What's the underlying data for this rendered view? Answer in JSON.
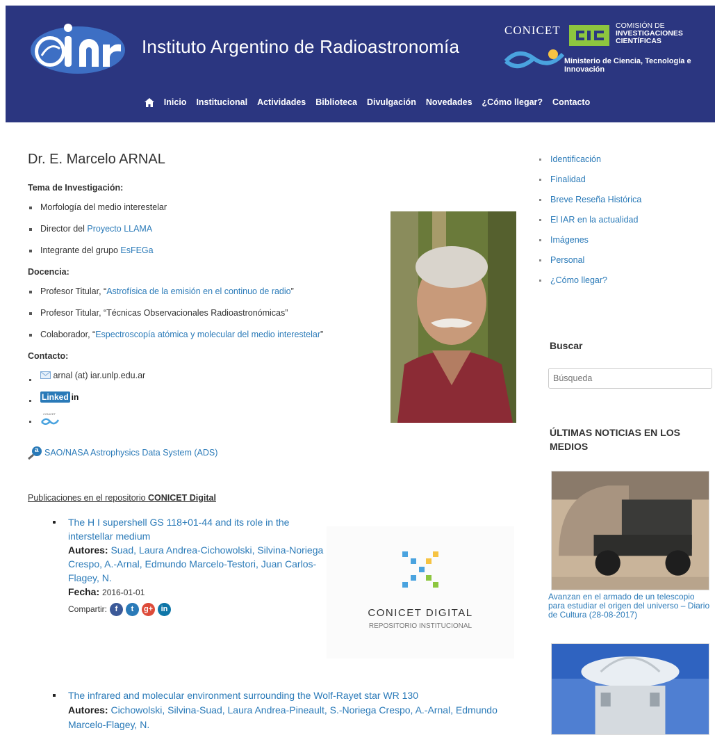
{
  "header": {
    "logo_text": "iar",
    "site_title": "Instituto Argentino de Radioastronomía",
    "partner": {
      "conicet": "CONICET",
      "cic_line1": "COMISIÓN DE",
      "cic_line2": "INVESTIGACIONES CIENTÍFICAS",
      "ministerio": "Ministerio de Ciencia, Tecnología e Innovación"
    }
  },
  "nav": {
    "items": [
      "Inicio",
      "Institucional",
      "Actividades",
      "Biblioteca",
      "Divulgación",
      "Novedades",
      "¿Cómo llegar?",
      "Contacto"
    ]
  },
  "main": {
    "title": "Dr. E. Marcelo ARNAL",
    "tema_heading": "Tema de Investigación:",
    "tema_items": [
      {
        "prefix": "Morfología del medio interestelar",
        "link": ""
      },
      {
        "prefix": "Director del ",
        "link": "Proyecto LLAMA"
      },
      {
        "prefix": "Integrante del grupo ",
        "link": "EsFEGa"
      }
    ],
    "docencia_heading": "Docencia:",
    "docencia_items": [
      {
        "prefix": "Profesor Titular, “",
        "link": "Astrofísica de la emisión en el continuo de radio",
        "suffix": "”"
      },
      {
        "prefix": "Profesor Titular, “Técnicas Observacionales Radioastronómicas”",
        "link": "",
        "suffix": ""
      },
      {
        "prefix": "Colaborador, “",
        "link": "Espectroscopía atómica y molecular del medio interestelar",
        "suffix": "”"
      }
    ],
    "contacto_heading": "Contacto:",
    "email": "arnal (at) iar.unlp.edu.ar",
    "linkedin_text": "Linked",
    "linkedin_in": "in",
    "conicet_small": "CONICET",
    "ads_badge": "a",
    "ads_link": "SAO/NASA Astrophysics Data System (ADS)",
    "pubs_heading_prefix": "Publicaciones en el repositorio ",
    "pubs_heading_bold": "CONICET Digital",
    "pubs": [
      {
        "title": "The H I supershell GS 118+01-44 and its role in the interstellar medium",
        "autores_label": "Autores:",
        "autores": "Suad, Laura Andrea-Cichowolski, Silvina-Noriega Crespo, A.-Arnal, Edmundo Marcelo-Testori, Juan Carlos-Flagey, N.",
        "fecha_label": "Fecha:",
        "fecha": "2016-01-01",
        "compartir": "Compartir:"
      }
    ],
    "pub2": {
      "title": "The infrared and molecular environment surrounding the Wolf-Rayet star WR 130",
      "autores_label": "Autores:",
      "autores": "Cichowolski, Silvina-Suad, Laura Andrea-Pineault, S.-Noriega Crespo, A.-Arnal, Edmundo Marcelo-Flagey, N."
    },
    "repo": {
      "name": "CONICET DIGITAL",
      "sub": "REPOSITORIO INSTITUCIONAL"
    },
    "social": [
      "f",
      "t",
      "g+",
      "in"
    ]
  },
  "sidebar": {
    "links": [
      "Identificación",
      "Finalidad",
      "Breve Reseña Histórica",
      "El IAR en la actualidad",
      "Imágenes",
      "Personal",
      "¿Cómo llegar?"
    ],
    "buscar_heading": "Buscar",
    "search_placeholder": "Búsqueda",
    "news_heading": "ÚLTIMAS NOTICIAS EN LOS MEDIOS",
    "news_caption": "Avanzan en el armado de un telescopio para estudiar el origen del universo – Diario de Cultura (28-08-2017)"
  },
  "colors": {
    "header_bg": "#2b3680",
    "link": "#2a7ab8",
    "cic_green": "#8dc63f"
  }
}
